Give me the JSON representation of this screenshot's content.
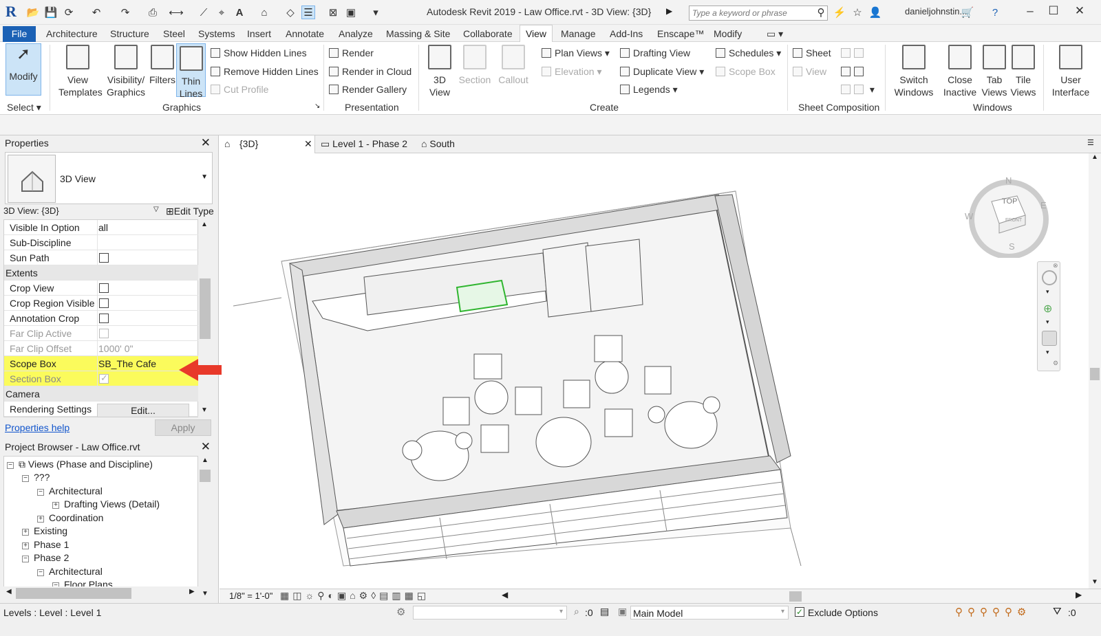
{
  "titlebar": {
    "app_title": "Autodesk Revit 2019 - Law Office.rvt - 3D View: {3D}",
    "search_placeholder": "Type a keyword or phrase",
    "user": "danieljohnstin..."
  },
  "menu": {
    "file": "File",
    "tabs": [
      "Architecture",
      "Structure",
      "Steel",
      "Systems",
      "Insert",
      "Annotate",
      "Analyze",
      "Massing & Site",
      "Collaborate",
      "View",
      "Manage",
      "Add-Ins",
      "Enscape™",
      "Modify"
    ],
    "active": "View"
  },
  "ribbon": {
    "modify": "Modify",
    "select": "Select",
    "graphics": {
      "view_templates": [
        "View",
        "Templates"
      ],
      "visibility": [
        "Visibility/",
        "Graphics"
      ],
      "filters": "Filters",
      "thin_lines": [
        "Thin",
        "Lines"
      ],
      "show_hidden": "Show  Hidden Lines",
      "remove_hidden": "Remove  Hidden Lines",
      "cut_profile": "Cut  Profile",
      "label": "Graphics"
    },
    "presentation": {
      "render": "Render",
      "render_cloud": "Render  in Cloud",
      "render_gallery": "Render  Gallery",
      "label": "Presentation"
    },
    "create": {
      "view_3d": [
        "3D",
        "View"
      ],
      "section": "Section",
      "callout": "Callout",
      "plan_views": "Plan  Views",
      "elevation": "Elevation",
      "drafting_view": "Drafting  View",
      "duplicate_view": "Duplicate  View",
      "legends": "Legends",
      "schedules": "Schedules",
      "scope_box": "Scope  Box",
      "label": "Create"
    },
    "sheet": {
      "sheet": "Sheet",
      "view": "View",
      "label": "Sheet Composition"
    },
    "windows": {
      "switch": [
        "Switch",
        "Windows"
      ],
      "close_inactive": [
        "Close",
        "Inactive"
      ],
      "tab_views": [
        "Tab",
        "Views"
      ],
      "tile_views": [
        "Tile",
        "Views"
      ],
      "label": "Windows"
    },
    "ui": [
      "User",
      "Interface"
    ]
  },
  "properties": {
    "title": "Properties",
    "type_name": "3D View",
    "instance": "3D View: {3D}",
    "edit_type": "Edit Type",
    "rows": {
      "visible_in_option": {
        "name": "Visible In Option",
        "value": "all"
      },
      "sub_discipline": {
        "name": "Sub-Discipline",
        "value": ""
      },
      "sun_path": {
        "name": "Sun Path"
      },
      "extents": "Extents",
      "crop_view": {
        "name": "Crop View"
      },
      "crop_region_visible": {
        "name": "Crop Region Visible"
      },
      "annotation_crop": {
        "name": "Annotation Crop"
      },
      "far_clip_active": {
        "name": "Far Clip Active"
      },
      "far_clip_offset": {
        "name": "Far Clip Offset",
        "value": "1000'  0\""
      },
      "scope_box": {
        "name": "Scope Box",
        "value": "SB_The Cafe"
      },
      "section_box": {
        "name": "Section Box"
      },
      "camera": "Camera",
      "rendering_settings": {
        "name": "Rendering Settings",
        "value": "Edit..."
      }
    },
    "help": "Properties help",
    "apply": "Apply"
  },
  "browser": {
    "title": "Project Browser - Law Office.rvt",
    "items": [
      {
        "label": "Views (Phase and Discipline)",
        "toggle": "−"
      },
      {
        "label": "???",
        "toggle": "−"
      },
      {
        "label": "Architectural",
        "toggle": "−"
      },
      {
        "label": "Drafting Views (Detail)",
        "toggle": "+"
      },
      {
        "label": "Coordination",
        "toggle": "+"
      },
      {
        "label": "Existing",
        "toggle": "+"
      },
      {
        "label": "Phase 1",
        "toggle": "+"
      },
      {
        "label": "Phase 2",
        "toggle": "−"
      },
      {
        "label": "Architectural",
        "toggle": "−"
      },
      {
        "label": "Floor Plans",
        "toggle": "−"
      }
    ]
  },
  "doc_tabs": [
    "{3D}",
    "Level 1 - Phase 2",
    "South"
  ],
  "view_bar": {
    "scale": "1/8\" = 1'-0\""
  },
  "navcube": {
    "top": "TOP",
    "front": "FRONT",
    "n": "N",
    "s": "S",
    "e": "E",
    "w": "W"
  },
  "status": {
    "text": "Levels : Level : Level 1",
    "zero": ":0",
    "model": "Main Model",
    "exclude": "Exclude Options"
  },
  "colors": {
    "accent": "#1b61b5",
    "highlight": "#fbfb5c",
    "arrow": "#e8392a",
    "selected": "#cce4f7"
  }
}
